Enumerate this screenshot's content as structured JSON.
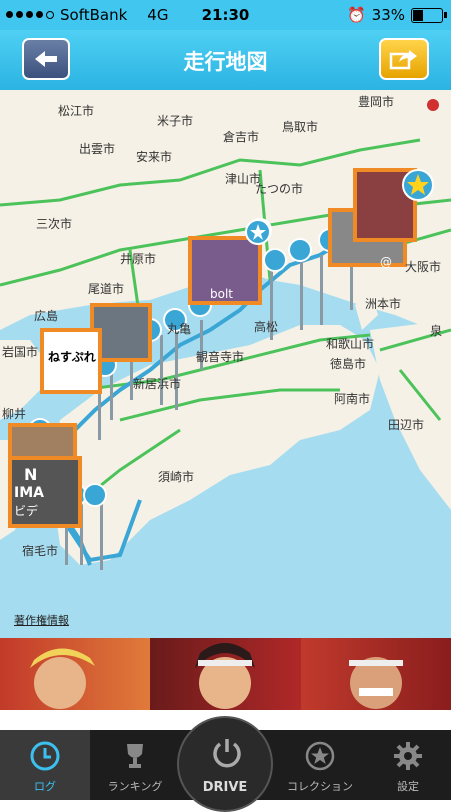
{
  "status": {
    "carrier": "SoftBank",
    "network": "4G",
    "time": "21:30",
    "battery": "33%"
  },
  "nav": {
    "title": "走行地図",
    "back_icon": "arrow-left-icon",
    "share_icon": "share-icon"
  },
  "map": {
    "copyright_label": "著作権情報",
    "cities": [
      "豊岡市",
      "松江市",
      "米子市",
      "倉吉市",
      "鳥取市",
      "出雲市",
      "安来市",
      "津山市",
      "たつの市",
      "三次市",
      "井原市",
      "尾道市",
      "広島",
      "岩国市",
      "柳井",
      "丸亀",
      "高松",
      "観音寺市",
      "新居浜市",
      "須崎市",
      "宿毛市",
      "徳島市",
      "阿南市",
      "和歌山市",
      "洲本市",
      "田辺市",
      "大阪市",
      "泉"
    ],
    "thumbnail_texts": [
      "ねすぷれ",
      "bolt",
      "N",
      "IMA",
      "ビデ",
      "@"
    ]
  },
  "tabs": [
    {
      "label": "ログ",
      "icon": "clock-icon"
    },
    {
      "label": "ランキング",
      "icon": "trophy-icon"
    },
    {
      "label": "DRIVE",
      "icon": "power-icon"
    },
    {
      "label": "コレクション",
      "icon": "star-icon"
    },
    {
      "label": "設定",
      "icon": "gear-icon"
    }
  ],
  "colors": {
    "accent": "#3cc0ee",
    "route": "#3aa6d6",
    "land": "#f5f1e6",
    "sea": "#a6dcef"
  }
}
